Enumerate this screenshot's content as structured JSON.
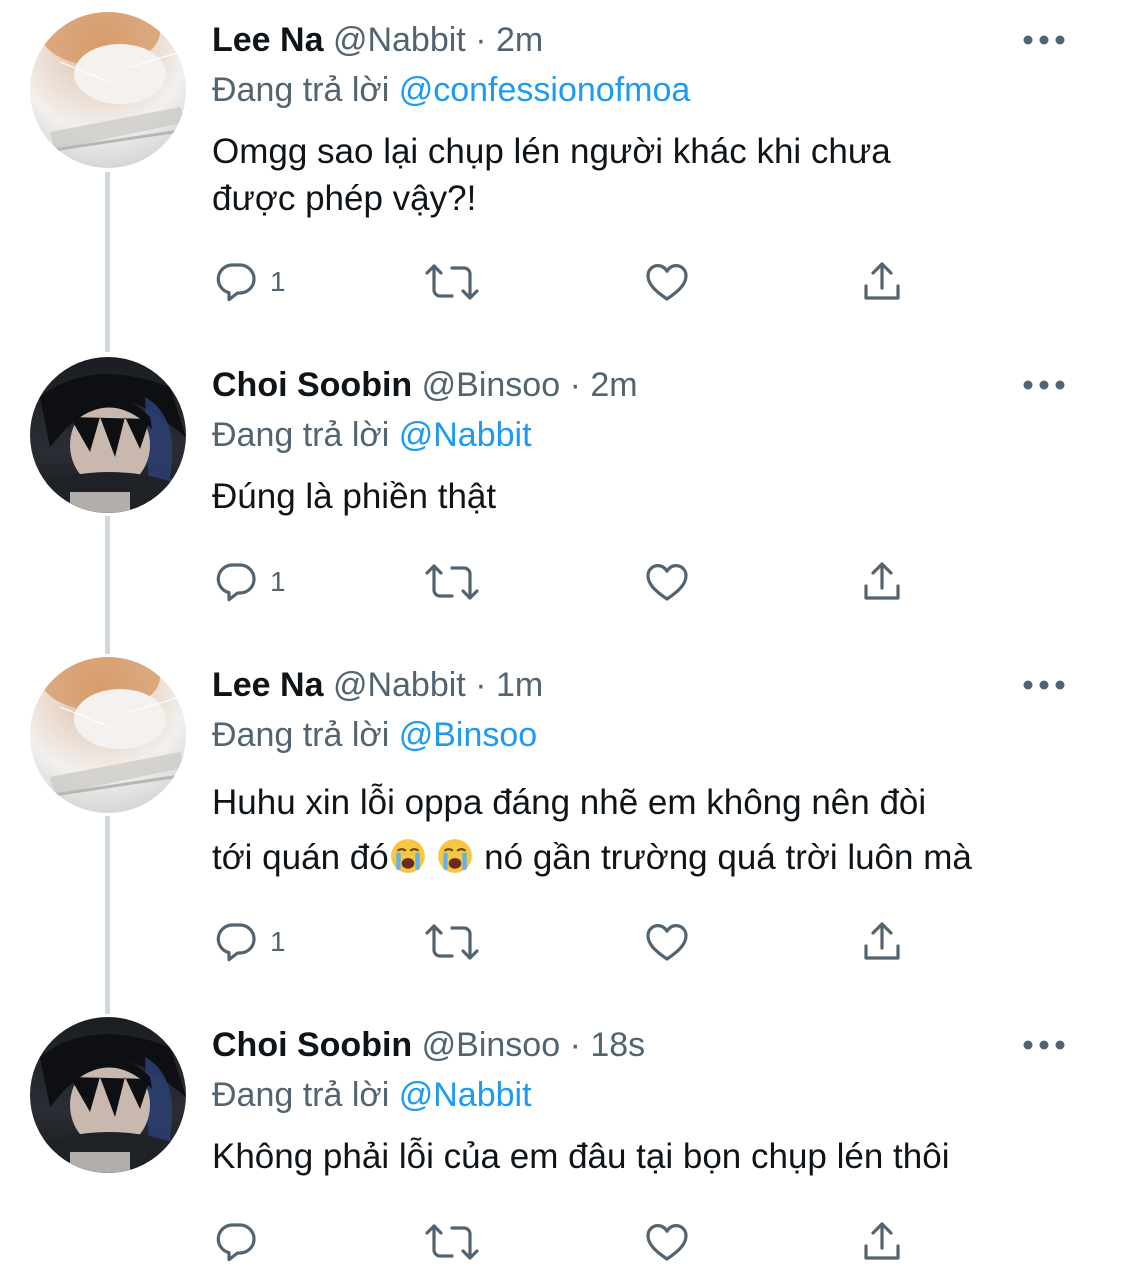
{
  "tweets": [
    {
      "name": "Lee Na",
      "handle": "@Nabbit",
      "time": "2m",
      "replying_prefix": "Đang trả lời",
      "replying_to": "@confessionofmoa",
      "text_lines": [
        "Omgg sao lại chụp lén người khác khi chưa",
        "được phép vậy?!"
      ],
      "reply_count": "1",
      "avatar": "cat-avatar"
    },
    {
      "name": "Choi Soobin",
      "handle": "@Binsoo",
      "time": "2m",
      "replying_prefix": "Đang trả lời",
      "replying_to": "@Nabbit",
      "text_lines": [
        "Đúng là phiền thật"
      ],
      "reply_count": "1",
      "avatar": "person-avatar"
    },
    {
      "name": "Lee Na",
      "handle": "@Nabbit",
      "time": "1m",
      "replying_prefix": "Đang trả lời",
      "replying_to": "@Binsoo",
      "text_lines": [
        "Huhu xin lỗi oppa đáng nhẽ em  không nên đòi"
      ],
      "text_line2_a": "tới quán đó",
      "text_line2_b": "nó gần trường quá trời luôn mà",
      "emoji": "loudly-crying-face",
      "reply_count": "1",
      "avatar": "cat-avatar"
    },
    {
      "name": "Choi Soobin",
      "handle": "@Binsoo",
      "time": "18s",
      "replying_prefix": "Đang trả lời",
      "replying_to": "@Nabbit",
      "text_lines": [
        "Không phải lỗi của em đâu tại bọn chụp lén thôi"
      ],
      "reply_count": "",
      "avatar": "person-avatar"
    }
  ],
  "separator": "·",
  "icons": {
    "reply": "reply-icon",
    "retweet": "retweet-icon",
    "like": "heart-icon",
    "share": "share-icon",
    "more": "more-options-icon"
  },
  "colors": {
    "text": "#0f1419",
    "secondary": "#536471",
    "mention": "#1d9bf0",
    "thread_line": "#cfd9de"
  }
}
